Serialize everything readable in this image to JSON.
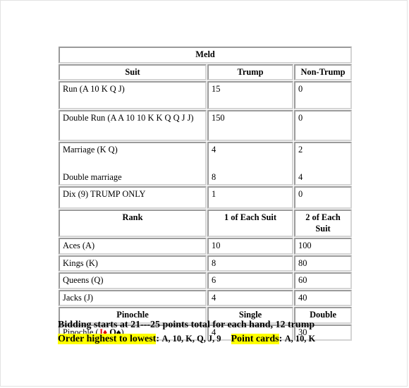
{
  "table": {
    "title": "Meld",
    "sections": [
      {
        "name": "meld-section",
        "header": {
          "label": "Suit",
          "col2": "Trump",
          "col3": "Non-Trump"
        },
        "rows": [
          {
            "label": "Run  (A 10 K Q J)",
            "label_plain": "Run",
            "label_cards": "(A 10 K Q J)",
            "trump": "15",
            "non_trump": "0"
          },
          {
            "label": "Double Run (A A 10 10 K K Q Q J J)",
            "label_plain": "Double Run",
            "label_cards": "(A A 10 10 K K Q Q J J)",
            "trump": "150",
            "non_trump": "0"
          },
          {
            "label": "Marriage (K Q)",
            "label_plain": "Marriage",
            "label_cards": "(K Q)",
            "label_second": "Double marriage",
            "trump": "4",
            "trump_second": "8",
            "non_trump": "2",
            "non_trump_second": "4"
          },
          {
            "label": "Dix (9) TRUMP ONLY",
            "label_plain": "Dix",
            "label_cards": "(9)",
            "label_suffix": "TRUMP ONLY",
            "trump": "1",
            "non_trump": "0"
          }
        ]
      },
      {
        "name": "rank-section",
        "header": {
          "label": "Rank",
          "col2": "1 of Each Suit",
          "col3": "2 of Each Suit"
        },
        "rows": [
          {
            "label_plain": "Aces",
            "label_cards": "(A)",
            "trump": "10",
            "non_trump": "100"
          },
          {
            "label_plain": "Kings",
            "label_cards": "(K)",
            "trump": "8",
            "non_trump": "80"
          },
          {
            "label_plain": "Queens",
            "label_cards": "(Q)",
            "trump": "6",
            "non_trump": "60"
          },
          {
            "label_plain": "Jacks",
            "label_cards": "(J)",
            "trump": "4",
            "non_trump": "40"
          }
        ]
      },
      {
        "name": "pinochle-section",
        "header": {
          "label": "Pinochle",
          "col2": "Single",
          "col3": "Double"
        },
        "rows": [
          {
            "label_plain": "Pinochle",
            "card_jack": "J",
            "suit_diamond": "♦",
            "card_queen": "Q",
            "suit_spade": "♠",
            "trump": "4",
            "non_trump": "30"
          }
        ]
      }
    ]
  },
  "footer": {
    "line1": "Bidding starts at 21---25 points total for each hand, 12 trump",
    "order_label": "Order highest to lowest",
    "order_colon": ":",
    "order_value": "A, 10, K, Q, J, 9",
    "point_label": "Point cards",
    "point_colon": ":",
    "point_value": "A, 10, K"
  },
  "colors": {
    "highlight": "#ffff00",
    "suit_red": "#e00000",
    "border": "#9a9a9a",
    "page_border": "#e2e2e2"
  }
}
